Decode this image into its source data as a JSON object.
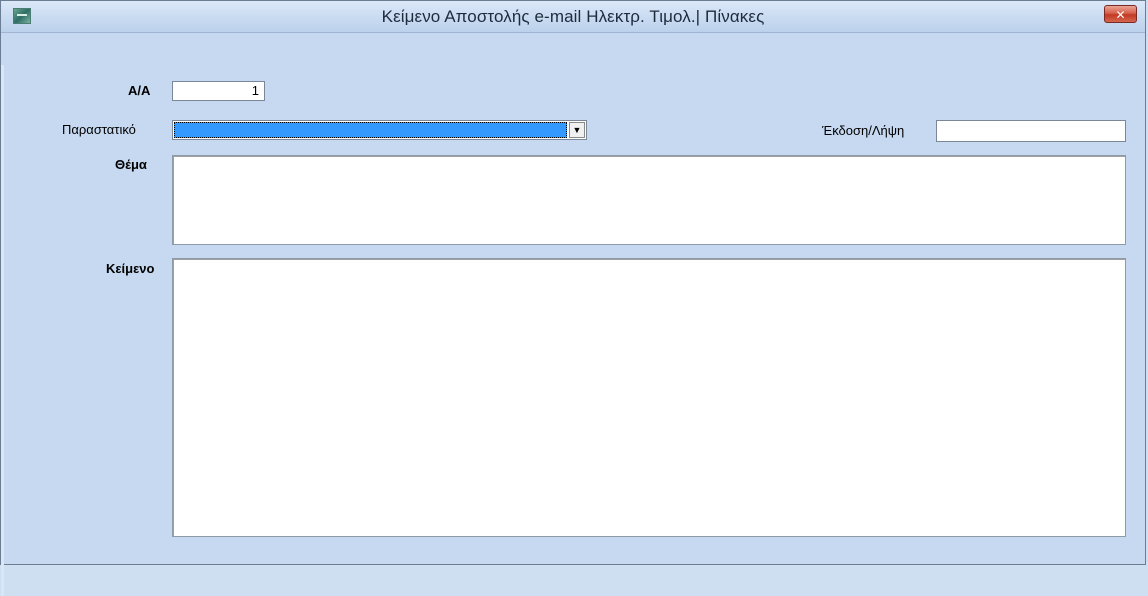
{
  "window": {
    "title": "Κείμενο Αποστολής e-mail Ηλεκτρ. Τιμολ.| Πίνακες",
    "close_glyph": "✕",
    "app_icon": "app-logo-icon"
  },
  "form": {
    "aa": {
      "label": "Α/Α",
      "value": "1"
    },
    "parastatiko": {
      "label": "Παραστατικό",
      "value": "",
      "dropdown_glyph": "▼"
    },
    "ekdosi_lipsi": {
      "label": "Έκδοση/Λήψη",
      "value": ""
    },
    "thema": {
      "label": "Θέμα",
      "value": ""
    },
    "keimeno": {
      "label": "Κείμενο",
      "value": ""
    }
  },
  "colors": {
    "background": "#c6d9f0",
    "selection": "#3399ff",
    "close_button": "#c23a24"
  }
}
